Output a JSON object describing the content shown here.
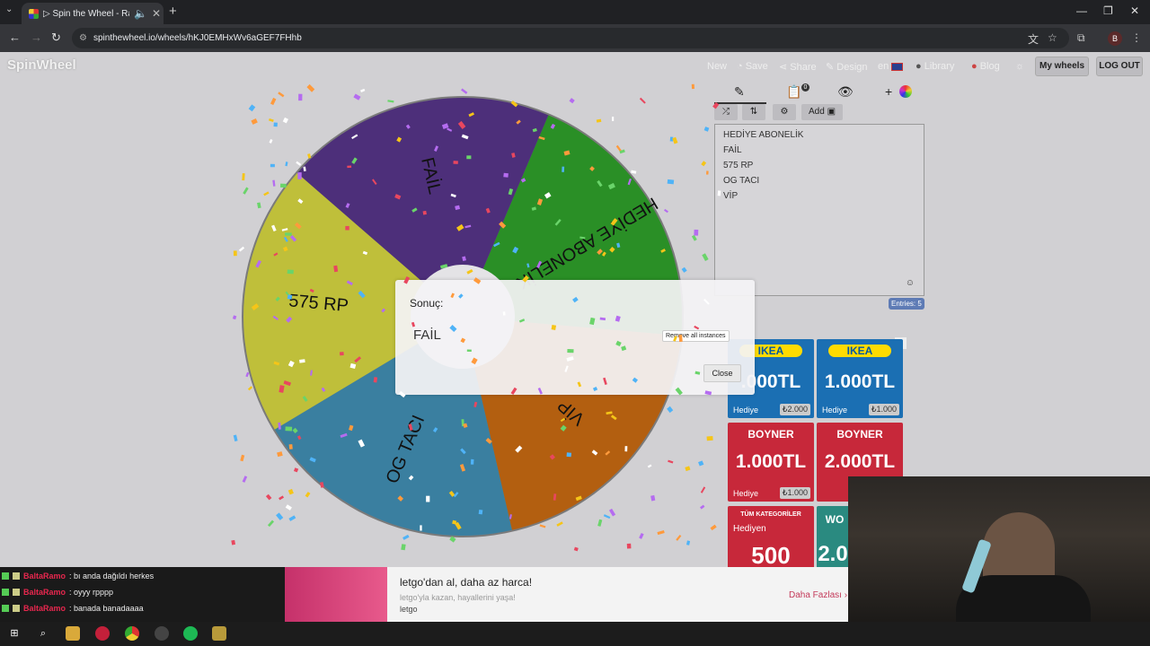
{
  "browser": {
    "tab_title": "▷ Spin the Wheel - Randon",
    "url": "spinthewheel.io/wheels/hKJ0EMHxWv6aGEF7FHhb",
    "profile_initial": "B"
  },
  "site": {
    "logo": "SpinWheel",
    "nav": {
      "new": "New",
      "save": "Save",
      "share": "Share",
      "design": "Design",
      "lang": "en",
      "library": "Library",
      "blog": "Blog",
      "my_wheels": "My wheels",
      "logout": "LOG OUT"
    },
    "tools": {
      "notification_count": "0",
      "add_label": "Add"
    },
    "entries": [
      "HEDİYE ABONELİK",
      "FAİL",
      "575 RP",
      "OG TACI",
      "VİP"
    ],
    "entries_count": "Entries: 5"
  },
  "wheel": {
    "segments": [
      {
        "label": "HEDİYE ABONELİK",
        "color": "#2a8f26"
      },
      {
        "label": "VİP",
        "color": "#b35f10"
      },
      {
        "label": "OG TACI",
        "color": "#3a7fa0"
      },
      {
        "label": "575 RP",
        "color": "#bfbf3a"
      },
      {
        "label": "FAİL",
        "color": "#4d2f7a"
      }
    ]
  },
  "dialog": {
    "title": "Sonuç:",
    "result": "FAİL",
    "remove_label": "Remove all instances",
    "close_label": "Close"
  },
  "ads": [
    {
      "brand": "IKEA",
      "amount": ".000TL",
      "hediye": "Hediye",
      "price": "₺2.000"
    },
    {
      "brand": "IKEA",
      "amount": "1.000TL",
      "hediye": "Hediye",
      "price": "₺1.000"
    },
    {
      "brand": "BOYNER",
      "amount": "1.000TL",
      "hediye": "Hediye",
      "price": "₺1.000"
    },
    {
      "brand": "BOYNER",
      "amount": "2.000TL",
      "hediye": "",
      "price": ""
    },
    {
      "brand": "TÜM KATEGORİLER",
      "amount": "500",
      "hediye": "Hediyen",
      "price": ""
    },
    {
      "brand": "WO",
      "amount": "2.0",
      "hediye": "",
      "price": ""
    }
  ],
  "chat": [
    {
      "user": "BaltaRamo",
      "message": ": bı anda dağıldı herkes"
    },
    {
      "user": "BaltaRamo",
      "message": ": oyyy rpppp"
    },
    {
      "user": "BaltaRamo",
      "message": ": banada banadaaaa"
    }
  ],
  "bottom_ad": {
    "title": "letgo'dan al, daha az harca!",
    "subtitle": "letgo'yla kazan, hayallerini yaşa!",
    "brand": "letgo",
    "cta": "Daha Fazlası"
  }
}
